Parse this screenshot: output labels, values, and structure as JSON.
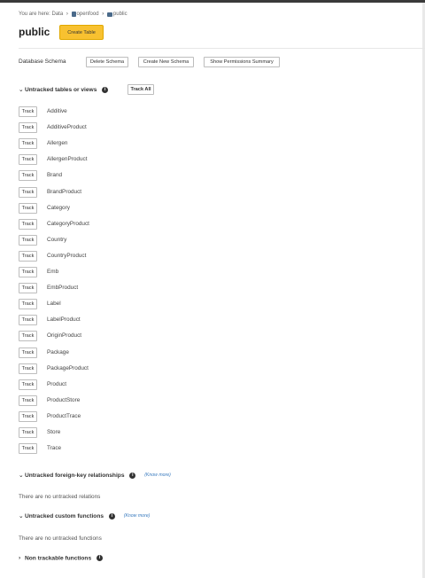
{
  "breadcrumb": {
    "prefix": "You are here:",
    "items": [
      "Data",
      "openfood",
      "public"
    ]
  },
  "page": {
    "title": "public",
    "create_table_label": "Create Table"
  },
  "schema": {
    "label": "Database Schema",
    "delete_label": "Delete Schema",
    "create_new_label": "Create New Schema",
    "permissions_label": "Show Permissions Summary"
  },
  "untracked_tables": {
    "title": "Untracked tables or views",
    "track_all_label": "Track All",
    "track_label": "Track",
    "items": [
      "Additive",
      "AdditiveProduct",
      "Allergen",
      "AllergenProduct",
      "Brand",
      "BrandProduct",
      "Category",
      "CategoryProduct",
      "Country",
      "CountryProduct",
      "Emb",
      "EmbProduct",
      "Label",
      "LabelProduct",
      "OriginProduct",
      "Package",
      "PackageProduct",
      "Product",
      "ProductStore",
      "ProductTrace",
      "Store",
      "Trace"
    ]
  },
  "foreign_keys": {
    "title": "Untracked foreign-key relationships",
    "know_more": "(Know more)",
    "message": "There are no untracked relations"
  },
  "custom_functions": {
    "title": "Untracked custom functions",
    "know_more": "(Know more)",
    "message": "There are no untracked functions"
  },
  "non_trackable": {
    "title": "Non trackable functions"
  },
  "colors": {
    "accent": "#f8c130",
    "link": "#3a7bbf",
    "topbar": "#3a3a3a"
  }
}
